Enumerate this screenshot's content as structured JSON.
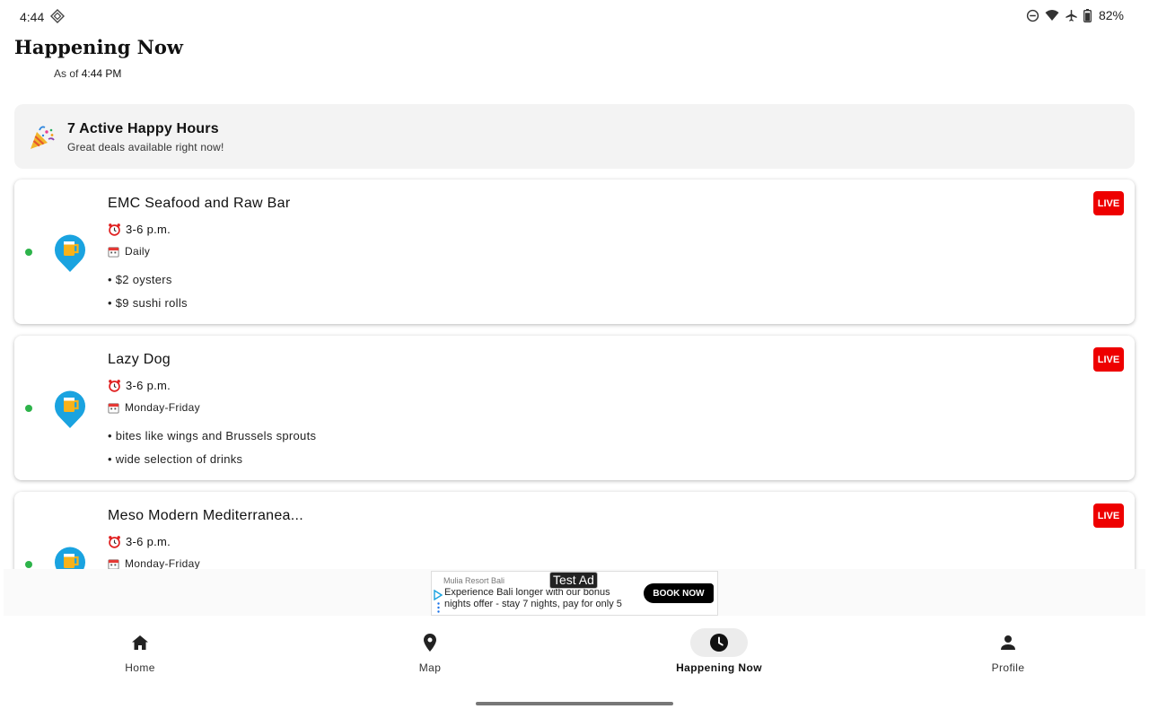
{
  "status_bar": {
    "time": "4:44",
    "battery": "82%",
    "icons": [
      "dnd-icon",
      "wifi-icon",
      "airplane-icon",
      "battery-icon"
    ]
  },
  "header": {
    "title": "Happening Now",
    "as_of_prefix": "As of",
    "as_of_time": "4:44 PM"
  },
  "summary": {
    "emoji": "party-popper-icon",
    "title": "7 Active Happy Hours",
    "subtitle": "Great deals available right now!"
  },
  "cards": [
    {
      "name": "EMC Seafood and Raw Bar",
      "time": "3-6 p.m.",
      "days": "Daily",
      "deals": [
        "• $2 oysters",
        "• $9 sushi rolls"
      ],
      "badge": "LIVE"
    },
    {
      "name": "Lazy Dog",
      "time": "3-6 p.m.",
      "days": "Monday-Friday",
      "deals": [
        "• bites like wings and Brussels sprouts",
        "• wide selection of drinks"
      ],
      "badge": "LIVE"
    },
    {
      "name": "Meso Modern Mediterranea...",
      "time": "3-6 p.m.",
      "days": "Monday-Friday",
      "deals": [],
      "badge": "LIVE"
    }
  ],
  "ad": {
    "label": "Test Ad",
    "sponsor": "Mulia Resort Bali",
    "line1": "Experience Bali longer with our bonus",
    "line2": "nights offer - stay 7 nights, pay for only 5",
    "cta": "BOOK NOW"
  },
  "nav": {
    "items": [
      {
        "label": "Home",
        "icon": "home-icon",
        "active": false
      },
      {
        "label": "Map",
        "icon": "map-pin-icon",
        "active": false
      },
      {
        "label": "Happening Now",
        "icon": "clock-icon",
        "active": true
      },
      {
        "label": "Profile",
        "icon": "person-icon",
        "active": false
      }
    ]
  },
  "colors": {
    "live_badge": "#ee0000",
    "active_dot": "#2db34a",
    "pin_blue": "#1aa3e0",
    "summary_bg": "#f3f3f3"
  }
}
